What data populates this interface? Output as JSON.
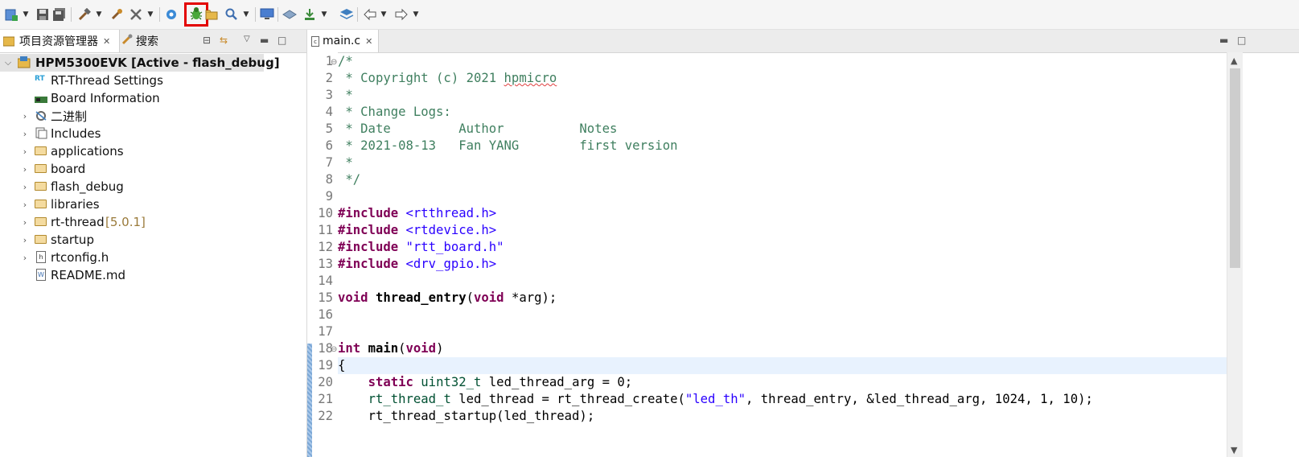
{
  "toolbar": {
    "items": [
      "new-icon",
      "save-icon",
      "save-all-icon",
      "build-icon",
      "build-settings-icon",
      "tools-icon",
      "settings-icon",
      "debug-icon",
      "open-folder-icon",
      "search-icon",
      "screen-icon",
      "package-icon",
      "download-icon",
      "layers-icon",
      "back-icon",
      "forward-icon"
    ]
  },
  "left_panel": {
    "tab_project": "项目资源管理器",
    "tab_search": "搜索",
    "project_name": "HPM5300EVK",
    "project_config": "[Active - flash_debug]",
    "items": [
      {
        "label": "RT-Thread Settings",
        "suffix": ""
      },
      {
        "label": "Board Information",
        "suffix": ""
      },
      {
        "label": "二进制",
        "suffix": ""
      },
      {
        "label": "Includes",
        "suffix": ""
      },
      {
        "label": "applications",
        "suffix": ""
      },
      {
        "label": "board",
        "suffix": ""
      },
      {
        "label": "flash_debug",
        "suffix": ""
      },
      {
        "label": "libraries",
        "suffix": ""
      },
      {
        "label": "rt-thread",
        "suffix": "[5.0.1]"
      },
      {
        "label": "startup",
        "suffix": ""
      },
      {
        "label": "rtconfig.h",
        "suffix": ""
      },
      {
        "label": "README.md",
        "suffix": ""
      }
    ]
  },
  "editor": {
    "tab": "main.c",
    "line_numbers": [
      "1",
      "2",
      "3",
      "4",
      "5",
      "6",
      "7",
      "8",
      "9",
      "10",
      "11",
      "12",
      "13",
      "14",
      "15",
      "16",
      "17",
      "18",
      "19",
      "20",
      "21",
      "22"
    ],
    "code": {
      "l1": "/*",
      "l2a": " * Copyright (c) 2021 ",
      "l2b": "hpmicro",
      "l3": " *",
      "l4": " * Change Logs:",
      "l5": " * Date         Author          Notes",
      "l6": " * 2021-08-13   Fan YANG        first version",
      "l7": " *",
      "l8": " */",
      "inc": "#include",
      "l10": "<rtthread.h>",
      "l11": "<rtdevice.h>",
      "l12": "\"rtt_board.h\"",
      "l13": "<drv_gpio.h>",
      "void": "void",
      "l15fn": "thread_entry",
      "l15rest": "(",
      "l15void": "void",
      "l15end": " *arg);",
      "int": "int",
      "main": "main",
      "l18b": "(",
      "l18c": "void",
      "l18d": ")",
      "l19": "{",
      "indent": "    ",
      "static": "static",
      "uint": "uint32_t",
      "l20rest": " led_thread_arg = 0;",
      "rtt": "rt_thread_t",
      "l21a": " led_thread = rt_thread_create(",
      "l21str": "\"led_th\"",
      "l21b": ", thread_entry, &led_thread_arg, 1024, 1, 10);",
      "l22": "rt_thread_startup(led_thread);"
    }
  },
  "colors": {
    "comment": "#3f7f5f",
    "keyword": "#7f0055",
    "string": "#2a00ff",
    "highlight": "#e30000",
    "current_line": "#e8f2fe"
  }
}
